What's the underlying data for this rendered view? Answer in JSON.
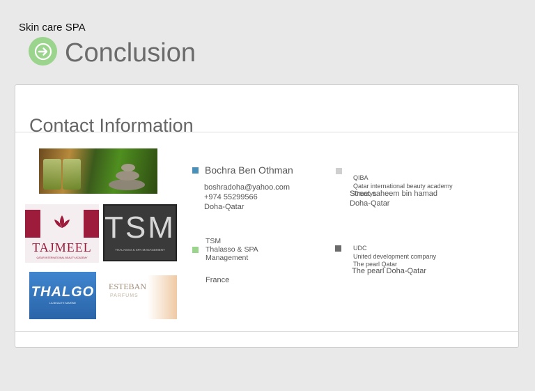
{
  "header": {
    "app_title": "Skin care SPA",
    "page_title": "Conclusion"
  },
  "section": {
    "title": "Contact Information"
  },
  "logos": {
    "tajmeel": {
      "name": "TAJMEEL",
      "subtitle": "QATAR INTERNATIONAL BEAUTY ACADEMY"
    },
    "tsm": {
      "name": "TSM",
      "subtitle": "THALASSO & SPA MANAGEMENT"
    },
    "thalgo": {
      "name": "THALGO",
      "subtitle": "LA BEAUTE MARINE"
    },
    "esteban": {
      "name": "ESTEBAN",
      "subtitle": "PARFUMS"
    }
  },
  "contacts": {
    "person": {
      "name": "Bochra Ben Othman",
      "email": "boshradoha@yahoo.com",
      "phone": "+974 55299566",
      "city": "Doha-Qatar"
    },
    "tsm": {
      "line1": "TSM",
      "line2": "Thalasso & SPA",
      "line3": "Management",
      "country": "France"
    },
    "qiba": {
      "line1": "QIBA",
      "line2": "Qatar international beauty academy",
      "line3": "Thuraya",
      "street": "Street saheem bin hamad",
      "city": "Doha-Qatar"
    },
    "udc": {
      "line1": "UDC",
      "line2": "United development company",
      "line3": "The pearl Qatar",
      "address": "The pearl Doha-Qatar"
    }
  },
  "colors": {
    "bullet_contact": "#4a8fb8",
    "bullet_tsm": "#9bd48c",
    "bullet_qiba": "#cfcfcf",
    "bullet_udc": "#6b6b6b",
    "accent_green": "#9bd48c"
  }
}
